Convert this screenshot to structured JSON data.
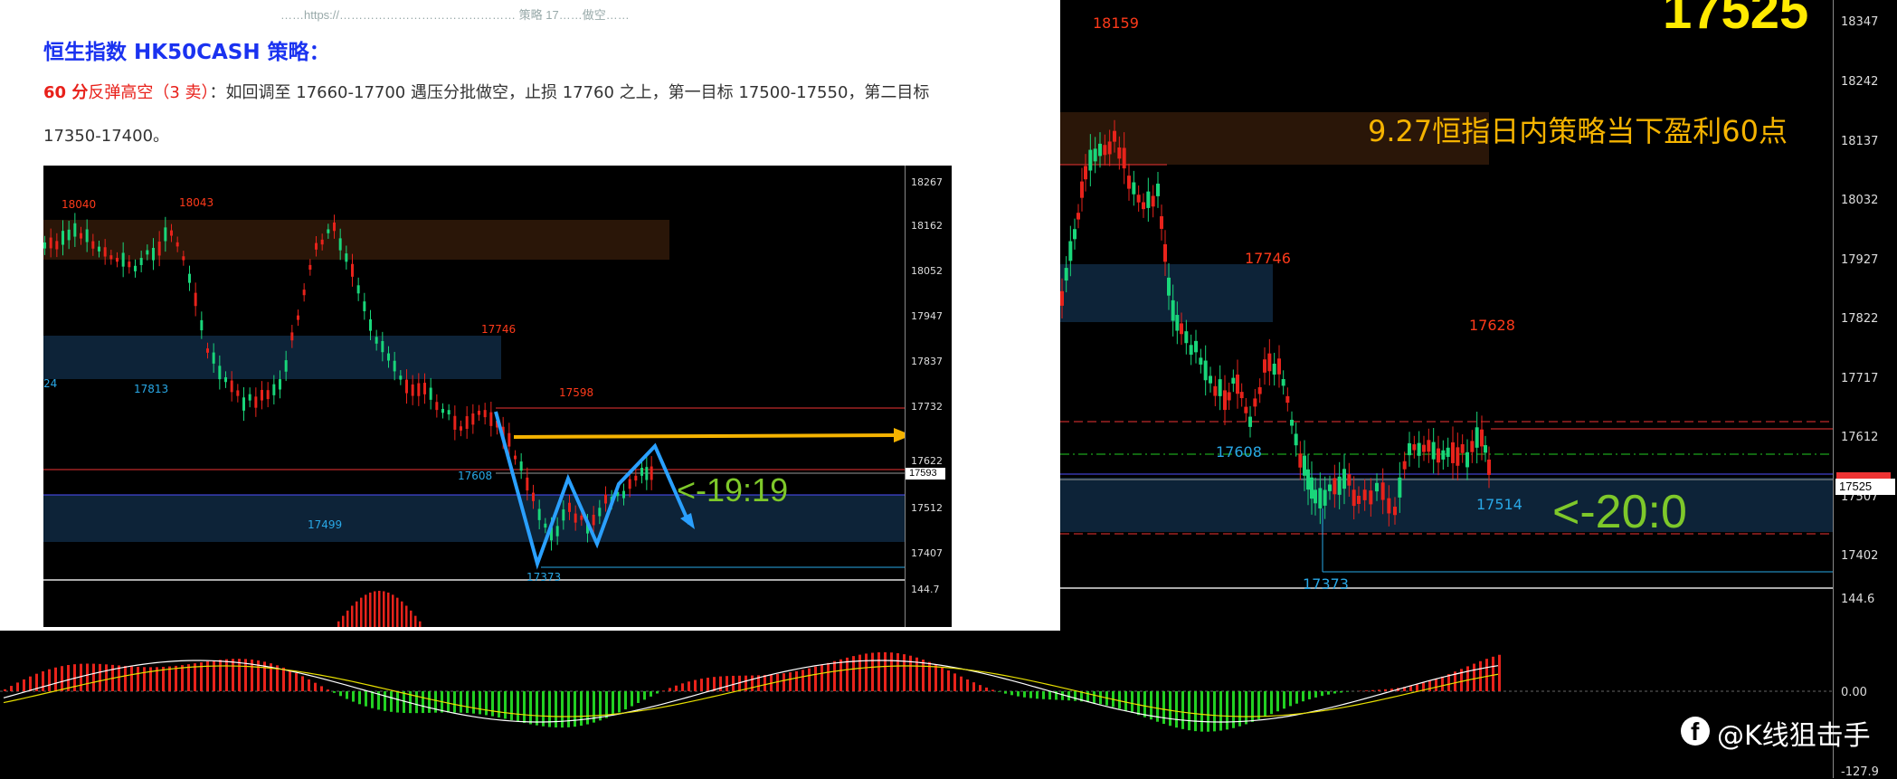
{
  "main_chart": {
    "current_price_big": "17525",
    "profit_title": "9.27恒指日内策略当下盈利60点",
    "countdown": "<-20:0",
    "axis_ticks": [
      "18347",
      "18242",
      "18137",
      "18032",
      "17927",
      "17822",
      "17717",
      "17612",
      "17507",
      "17402",
      "144.6",
      "0.00",
      "-127.9"
    ],
    "axis_current": "17525",
    "labels_red": [
      "18159",
      "17746",
      "17628"
    ],
    "labels_blue": [
      "17608",
      "17514",
      "17373"
    ],
    "colors": {
      "bull": "#19d67a",
      "bear": "#e8231b",
      "accent": "#f5b300",
      "zone_blue": "#0d2338",
      "zone_brown": "#2a1608"
    }
  },
  "watermark": {
    "icon": "facebook-icon",
    "text": "@K线狙击手"
  },
  "document": {
    "top_line": "……https://……………………………………… 策略 17……做空……",
    "heading": "恒生指数 HK50CASH 策略：",
    "strategy_emph": "60 分",
    "strategy_type": "反弹高空（3 卖）",
    "strategy_body": "：如回调至 17660-17700 遇压分批做空，止损 17760 之上，第一目标 17500-17550，第二目标",
    "strategy_line2": "17350-17400。",
    "inner_chart": {
      "axis_ticks": [
        "18267",
        "18162",
        "18052",
        "17947",
        "17837",
        "17732",
        "17622",
        "17512",
        "17407",
        "144.7"
      ],
      "axis_current": "17593",
      "labels_red": [
        "18040",
        "18043",
        "17746",
        "17598"
      ],
      "labels_blue": [
        "24",
        "17813",
        "17608",
        "17499",
        "17373"
      ],
      "countdown": "<-19:19"
    }
  }
}
